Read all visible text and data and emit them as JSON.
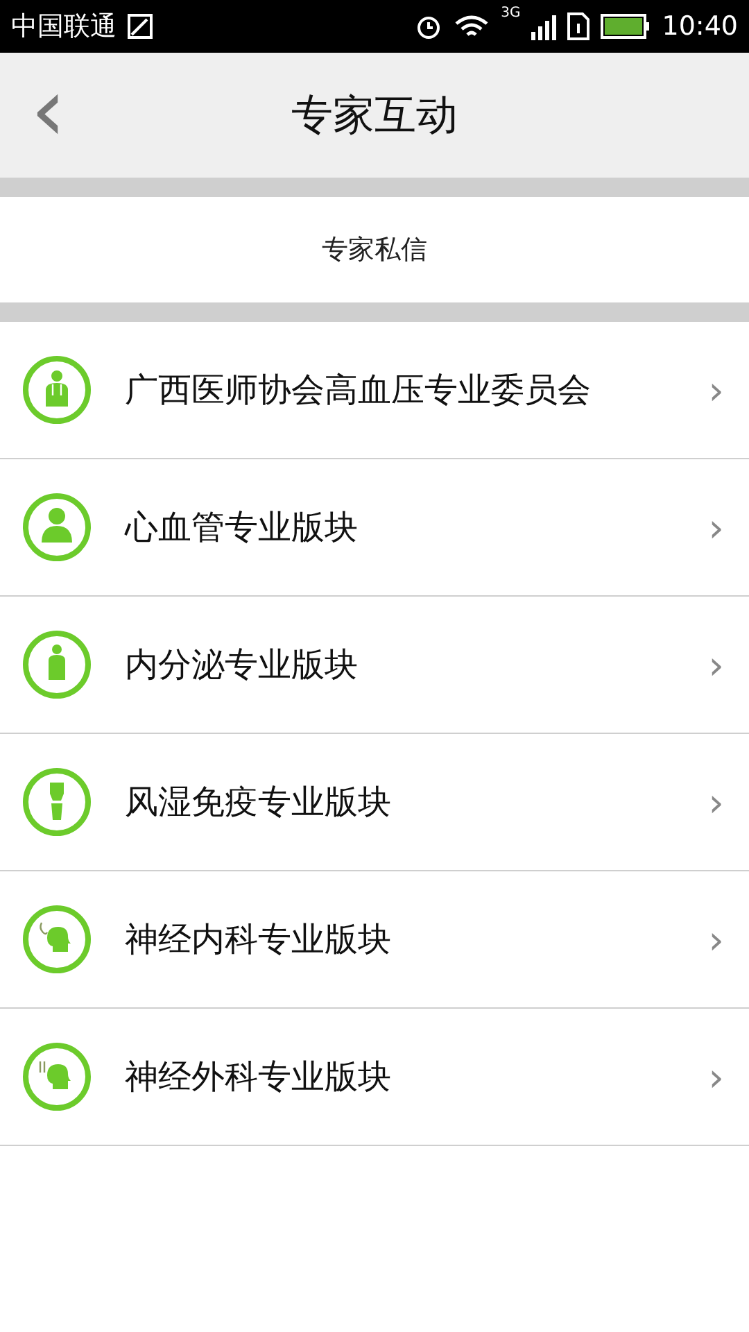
{
  "status_bar": {
    "carrier": "中国联通",
    "network": "3G",
    "time": "10:40"
  },
  "header": {
    "back": "‹",
    "title": "专家互动"
  },
  "section": {
    "label": "专家私信"
  },
  "items": [
    {
      "kind": "doctor",
      "label": "广西医师协会高血压专业委员会",
      "chevron": "›"
    },
    {
      "kind": "person",
      "label": "心血管专业版块",
      "chevron": "›"
    },
    {
      "kind": "body",
      "label": "内分泌专业版块",
      "chevron": "›"
    },
    {
      "kind": "knee",
      "label": "风湿免疫专业版块",
      "chevron": "›"
    },
    {
      "kind": "head-stethoscope",
      "label": "神经内科专业版块",
      "chevron": "›"
    },
    {
      "kind": "head-tools",
      "label": "神经外科专业版块",
      "chevron": "›"
    }
  ]
}
